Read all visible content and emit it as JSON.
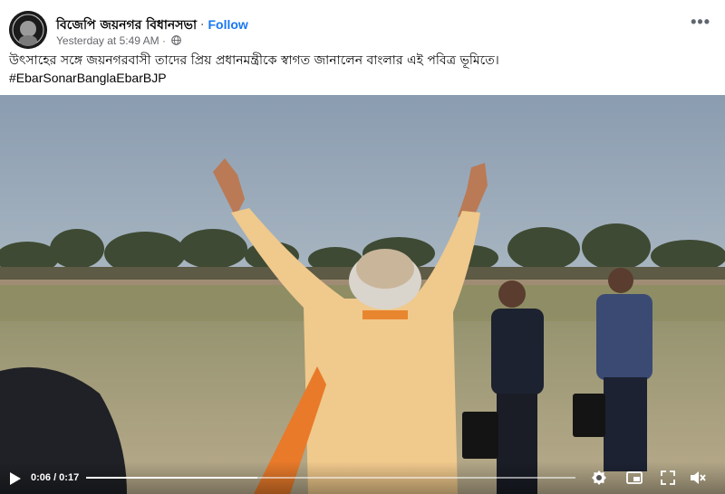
{
  "post": {
    "page_name": "বিজেপি জয়নগর বিধানসভা",
    "follow_label": "Follow",
    "timestamp": "Yesterday at 5:49 AM",
    "more_label": "•••",
    "caption": "উৎসাহের সঙ্গে জয়নগরবাসী তাদের প্রিয় প্রধানমন্ত্রীকে স্বাগত জানালেন বাংলার এই পবিত্র ভূমিতে।",
    "hashtag": "#EbarSonarBanglaEbarBJP"
  },
  "video": {
    "current_time": "0:06",
    "duration": "0:17",
    "time_display": "0:06 / 0:17",
    "progress": 0.35
  },
  "icons": {
    "play": "play-icon",
    "settings": "gear-icon",
    "pip": "picture-in-picture-icon",
    "fullscreen": "fullscreen-icon",
    "mute": "speaker-muted-icon",
    "privacy": "globe-icon"
  },
  "colors": {
    "follow": "#1877f2",
    "meta": "#65676b",
    "text": "#050505"
  }
}
